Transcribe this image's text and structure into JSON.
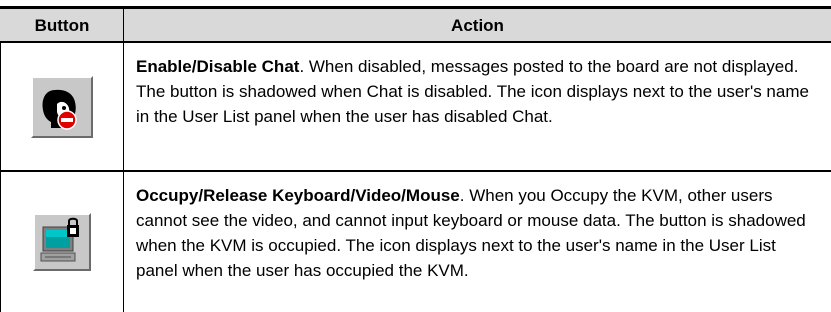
{
  "table": {
    "header_button": "Button",
    "header_action": "Action",
    "rows": [
      {
        "icon": "chat-disable-icon",
        "title": "Enable/Disable Chat",
        "text": ". When disabled, messages posted to the board are not displayed. The button is shadowed when Chat is disabled. The icon displays next to the user's name in the User List panel when the user has disabled Chat."
      },
      {
        "icon": "kvm-occupy-icon",
        "title": "Occupy/Release Keyboard/Video/Mouse",
        "text": ". When you Occupy the KVM, other users cannot see the video, and cannot input keyboard or mouse data. The button is shadowed when the KVM is occupied. The icon displays next to the user's name in the User List panel when the user has occupied the KVM."
      }
    ]
  }
}
